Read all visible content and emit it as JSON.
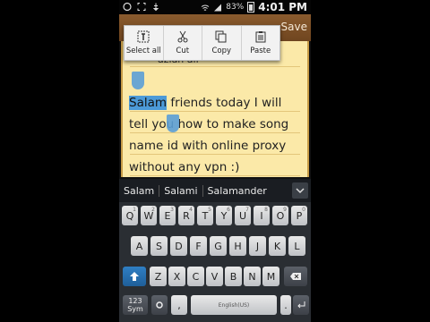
{
  "status_bar": {
    "battery_pct": "83%",
    "time": "4:01 PM"
  },
  "app_bar": {
    "save_label": "Save"
  },
  "context_menu": [
    {
      "label": "Select all",
      "icon": "select-all-icon"
    },
    {
      "label": "Cut",
      "icon": "scissors-icon"
    },
    {
      "label": "Copy",
      "icon": "copy-icon"
    },
    {
      "label": "Paste",
      "icon": "paste-icon"
    }
  ],
  "note": {
    "partial_line": "azlan ali",
    "selected_word": "Salam",
    "body_after_selection": " friends today I will tell you how to make song name id with online proxy without any vpn :)"
  },
  "suggestions": [
    "Salam",
    "Salami",
    "Salamander"
  ],
  "keyboard": {
    "row1": [
      "Q",
      "W",
      "E",
      "R",
      "T",
      "Y",
      "U",
      "I",
      "O",
      "P"
    ],
    "row1_sup": [
      "1",
      "2",
      "3",
      "4",
      "5",
      "6",
      "7",
      "8",
      "9",
      "0"
    ],
    "row2": [
      "A",
      "S",
      "D",
      "F",
      "G",
      "H",
      "J",
      "K",
      "L"
    ],
    "row3": [
      "Z",
      "X",
      "C",
      "V",
      "B",
      "N",
      "M"
    ],
    "sym_label": "123\nSym",
    "space_label": "English(US)",
    "comma": ",",
    "period": "."
  },
  "colors": {
    "selection": "#4c9ad8",
    "paper": "#fbe9a8",
    "app_bar": "#7a4e25"
  }
}
